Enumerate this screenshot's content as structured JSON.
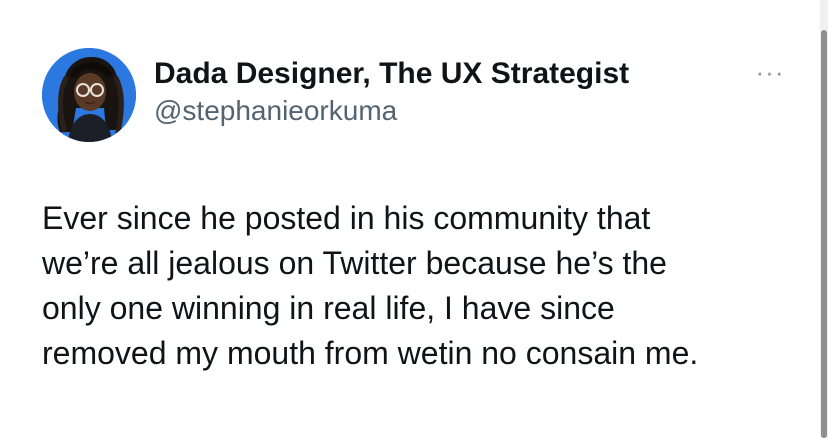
{
  "tweet": {
    "author": {
      "display_name": "Dada Designer, The UX Strategist",
      "handle": "@stephanieorkuma",
      "avatar_icon": "profile-photo-icon"
    },
    "more_label": "···",
    "text": "Ever since he posted in his community that\nwe’re all jealous on Twitter because he’s the\nonly one winning in real life, I have since\nremoved my mouth from wetin no consain me."
  },
  "colors": {
    "background": "#ffffff",
    "name": "#0f1419",
    "handle": "#536471",
    "avatar_bg": "#2c7be5",
    "more_icon": "#8b98a5"
  }
}
